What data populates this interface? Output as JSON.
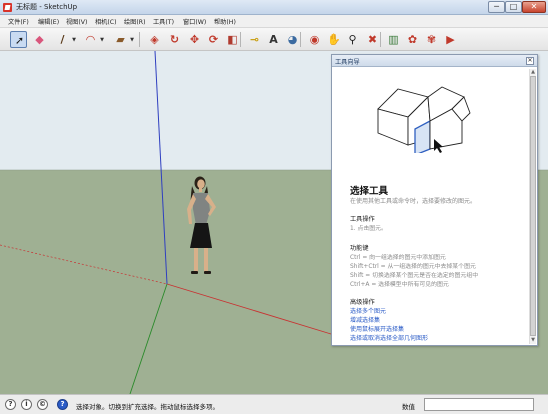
{
  "window": {
    "title": "无标题 - SketchUp",
    "min": "─",
    "max": "□",
    "close": "✕"
  },
  "menu": [
    "文件(F)",
    "编辑(E)",
    "视图(V)",
    "相机(C)",
    "绘图(R)",
    "工具(T)",
    "窗口(W)",
    "帮助(H)"
  ],
  "toolbar": {
    "tools": [
      {
        "name": "select-tool",
        "icon": "arrow-cursor-icon",
        "glyph": "➚",
        "color": "#1a1a1a",
        "active": true
      },
      {
        "name": "eraser-tool",
        "icon": "eraser-icon",
        "glyph": "◆",
        "color": "#d9567c"
      },
      {
        "name": "line-tool",
        "icon": "pencil-icon",
        "glyph": "/",
        "color": "#5a3a1a",
        "dropdown": true
      },
      {
        "name": "arc-tool",
        "icon": "arc-icon",
        "glyph": "◠",
        "color": "#c0392b",
        "dropdown": true
      },
      {
        "name": "shape-tool",
        "icon": "rectangle-icon",
        "glyph": "▰",
        "color": "#8a5a2a",
        "dropdown": true
      },
      {
        "name": "push-pull-tool",
        "icon": "push-pull-icon",
        "glyph": "◈",
        "color": "#c0392b"
      },
      {
        "name": "follow-me-tool",
        "icon": "follow-me-icon",
        "glyph": "↻",
        "color": "#c0392b"
      },
      {
        "name": "move-tool",
        "icon": "move-icon",
        "glyph": "✥",
        "color": "#c0392b"
      },
      {
        "name": "rotate-tool",
        "icon": "rotate-icon",
        "glyph": "⟳",
        "color": "#c0392b"
      },
      {
        "name": "scale-tool",
        "icon": "scale-icon",
        "glyph": "◧",
        "color": "#b03a2e"
      },
      {
        "name": "tape-measure-tool",
        "icon": "tape-measure-icon",
        "glyph": "⊸",
        "color": "#caa21a"
      },
      {
        "name": "text-tool",
        "icon": "text-icon",
        "glyph": "A",
        "color": "#333333"
      },
      {
        "name": "paint-bucket-tool",
        "icon": "paint-bucket-icon",
        "glyph": "◕",
        "color": "#3b6aa0"
      },
      {
        "name": "orbit-tool",
        "icon": "orbit-icon",
        "glyph": "◉",
        "color": "#c0392b"
      },
      {
        "name": "pan-tool",
        "icon": "hand-icon",
        "glyph": "✋",
        "color": "#c08a5a"
      },
      {
        "name": "zoom-tool",
        "icon": "magnifier-icon",
        "glyph": "⚲",
        "color": "#222222"
      },
      {
        "name": "zoom-extents-tool",
        "icon": "zoom-extents-icon",
        "glyph": "✖",
        "color": "#c0392b"
      },
      {
        "name": "warehouse-tool",
        "icon": "warehouse-icon",
        "glyph": "▥",
        "color": "#3b7a3b"
      },
      {
        "name": "get-models-tool",
        "icon": "get-models-icon",
        "glyph": "✿",
        "color": "#c0392b"
      },
      {
        "name": "share-model-tool",
        "icon": "share-model-icon",
        "glyph": "✾",
        "color": "#c0392b"
      },
      {
        "name": "extension-warehouse-tool",
        "icon": "extension-warehouse-icon",
        "glyph": "▶",
        "color": "#c0392b"
      }
    ]
  },
  "colors": {
    "sky": "#e3ebf0",
    "ground": "#9fb093",
    "axis_red": "#c83232",
    "axis_green": "#2a8a2a",
    "axis_blue": "#2f3fc0",
    "link": "#2a5bc7"
  },
  "instructor": {
    "title": "工具向导",
    "close": "✕",
    "tool_name": "选择工具",
    "tool_desc": "在使用其他工具或命令时，选择要修改的图元。",
    "ops_heading": "工具操作",
    "ops": [
      "1.   点击图元。"
    ],
    "keys_heading": "功能键",
    "keys": [
      "Ctrl = 向一组选择的图元中添加图元",
      "Shift+Ctrl = 从一组选择的图元中去掉某个图元",
      "Shift = 切换选择某个图元是否在选定的图元组中",
      "Ctrl+A = 选择模型中所有可见的图元"
    ],
    "adv_heading": "高级操作",
    "adv_links": [
      "选择多个图元",
      "增减选择集",
      "使用鼠标展开选择集",
      "选择或取消选择全部几何图形"
    ]
  },
  "status": {
    "icons": [
      {
        "name": "geo-location-icon",
        "glyph": "?"
      },
      {
        "name": "info-icon",
        "glyph": "i"
      },
      {
        "name": "credits-icon",
        "glyph": "©"
      },
      {
        "name": "help-icon",
        "glyph": "?"
      }
    ],
    "text": "选择对象。切换到扩充选择。拖动鼠标选择多项。",
    "measurements_label": "数值",
    "measurements_value": ""
  }
}
